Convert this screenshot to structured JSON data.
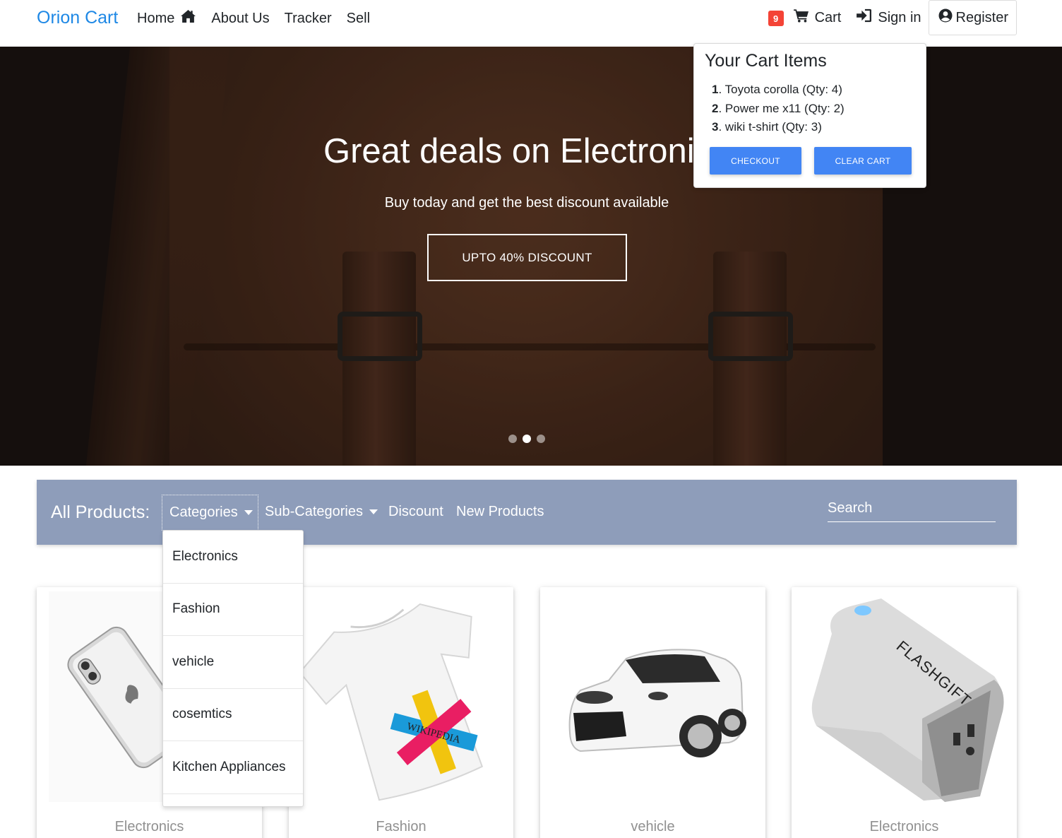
{
  "navbar": {
    "brand": "Orion Cart",
    "links": [
      {
        "label": "Home",
        "icon": "home-icon"
      },
      {
        "label": "About Us"
      },
      {
        "label": "Tracker"
      },
      {
        "label": "Sell"
      }
    ],
    "cart_count": "9",
    "cart_label": "Cart",
    "signin_label": "Sign in",
    "register_label": "Register"
  },
  "hero": {
    "title": "Great deals on Electroni",
    "subtitle": "Buy today and get the best discount available",
    "button_label": "UPTO 40% DISCOUNT",
    "slides": 3,
    "active_slide": 2
  },
  "cart_popup": {
    "title": "Your Cart Items",
    "items": [
      {
        "num": "1",
        "text": "Toyota corolla (Qty: 4)"
      },
      {
        "num": "2",
        "text": "Power me x11 (Qty: 2)"
      },
      {
        "num": "3",
        "text": "wiki t-shirt (Qty: 3)"
      }
    ],
    "checkout_label": "CHECKOUT",
    "clear_label": "CLEAR CART"
  },
  "filter": {
    "label": "All Products:",
    "categories_label": "Categories",
    "subcategories_label": "Sub-Categories",
    "discount_label": "Discount",
    "new_products_label": "New Products",
    "search_placeholder": "Search"
  },
  "dropdown": {
    "items": [
      "Electronics",
      "Fashion",
      "vehicle",
      "cosemtics",
      "Kitchen Appliances"
    ]
  },
  "products": [
    {
      "category": "Electronics",
      "image": "smartphone"
    },
    {
      "category": "Fashion",
      "image": "wikipedia-tshirt"
    },
    {
      "category": "vehicle",
      "image": "white-sedan-car"
    },
    {
      "category": "Electronics",
      "image": "power-bank",
      "brand_text": "FLASHGIFT"
    }
  ],
  "colors": {
    "brand": "#1e88e5",
    "badge": "#f44336",
    "button": "#4285f4",
    "filter_bar": "#8e9dba"
  }
}
